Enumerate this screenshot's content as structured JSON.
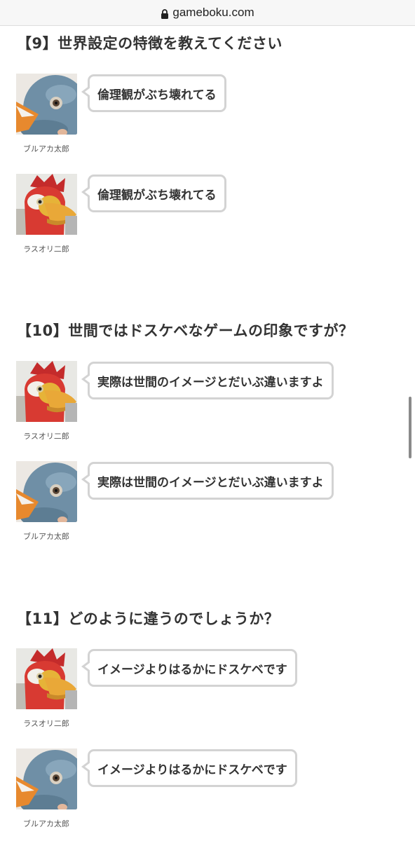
{
  "browser": {
    "url": "gameboku.com"
  },
  "sections": [
    {
      "heading": "【9】世界設定の特徴を教えてください",
      "messages": [
        {
          "speaker": "ブルアカ太郎",
          "avatar": "pigeon-mask-icon",
          "text": "倫理観がぶち壊れてる"
        },
        {
          "speaker": "ラスオリ二郎",
          "avatar": "rooster-mask-icon",
          "text": "倫理観がぶち壊れてる"
        }
      ]
    },
    {
      "heading": "【10】世間ではドスケベなゲームの印象ですが？",
      "messages": [
        {
          "speaker": "ラスオリ二郎",
          "avatar": "rooster-mask-icon",
          "text": "実際は世間のイメージとだいぶ違いますよ"
        },
        {
          "speaker": "ブルアカ太郎",
          "avatar": "pigeon-mask-icon",
          "text": "実際は世間のイメージとだいぶ違いますよ"
        }
      ]
    },
    {
      "heading": "【11】どのように違うのでしょうか？",
      "messages": [
        {
          "speaker": "ラスオリ二郎",
          "avatar": "rooster-mask-icon",
          "text": "イメージよりはるかにドスケベです"
        },
        {
          "speaker": "ブルアカ太郎",
          "avatar": "pigeon-mask-icon",
          "text": "イメージよりはるかにドスケベです"
        }
      ]
    }
  ]
}
